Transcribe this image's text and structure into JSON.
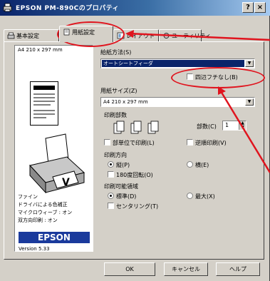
{
  "window": {
    "title": "EPSON PM-890Cのプロパティ"
  },
  "titlebar": {
    "help": "?",
    "close": "×"
  },
  "tabs": [
    {
      "label": "基本設定",
      "icon": "printer-small-icon"
    },
    {
      "label": "用紙設定",
      "icon": "paper-small-icon",
      "active": true
    },
    {
      "label": "レイアウト",
      "icon": "layout-small-icon"
    },
    {
      "label": "ユーティリティ",
      "icon": "utility-small-icon"
    }
  ],
  "preview": {
    "paper_size": "A4 210 x 297 mm",
    "status": [
      "ファイン",
      "ドライバによる色補正",
      "マイクロウィーブ : オン",
      "双方向印刷 : オン"
    ],
    "brand": "EPSON",
    "version": "Version 5.33"
  },
  "feed": {
    "label": "給紙方法(S)",
    "value": "オートシートフィーダ"
  },
  "borderless": {
    "label": "四辺フチなし(B)",
    "checked": false
  },
  "paper_size": {
    "label": "用紙サイズ(Z)",
    "value": "A4 210 x 297 mm"
  },
  "copies": {
    "label": "印刷部数",
    "count_label": "部数(C)",
    "count": "1",
    "collate_label": "部単位で印刷(L)",
    "reverse_label": "逆順印刷(V)"
  },
  "orientation": {
    "label": "印刷方向",
    "portrait": "縦(P)",
    "landscape": "横(E)",
    "rotate": "180度回転(O)"
  },
  "print_area": {
    "label": "印刷可能領域",
    "standard": "標準(D)",
    "max": "最大(X)",
    "centering": "センタリング(T)"
  },
  "buttons": {
    "ok": "OK",
    "cancel": "キャンセル",
    "help": "ヘルプ"
  },
  "colors": {
    "annotation": "#e0141e",
    "titlebar": "#0a246a",
    "brand": "#1a3a9c"
  }
}
